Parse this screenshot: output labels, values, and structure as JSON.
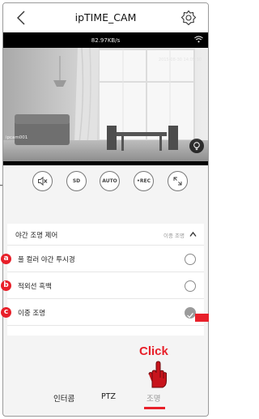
{
  "header": {
    "title": "ipTIME_CAM",
    "back_icon": "chevron-left-icon",
    "settings_icon": "gear-icon"
  },
  "video": {
    "bitrate": "82.97KB/s",
    "camera_label": "ipcam001",
    "timestamp": "2015-08-30 14:05:30"
  },
  "controls": [
    {
      "name": "mute",
      "icon": "speaker-mute-icon"
    },
    {
      "name": "sd",
      "label": "SD"
    },
    {
      "name": "auto",
      "label": "AUTO"
    },
    {
      "name": "rec",
      "label": "•REC"
    },
    {
      "name": "fullscreen",
      "icon": "expand-icon"
    }
  ],
  "night_light": {
    "label": "야간 조명 제어",
    "current_value": "이중 조명",
    "options": [
      {
        "badge": "a",
        "label": "풀 컬러 야간 투시경",
        "selected": false
      },
      {
        "badge": "b",
        "label": "적외선 흑백",
        "selected": false
      },
      {
        "badge": "c",
        "label": "이중 조명",
        "selected": true
      }
    ]
  },
  "annotation": {
    "click_text": "Click"
  },
  "tabs": [
    {
      "label": "인터콤"
    },
    {
      "label": "PTZ"
    },
    {
      "label": "조명",
      "active": true
    }
  ],
  "colors": {
    "accent": "#e8202a",
    "selected_radio": "#9b9b9b"
  }
}
